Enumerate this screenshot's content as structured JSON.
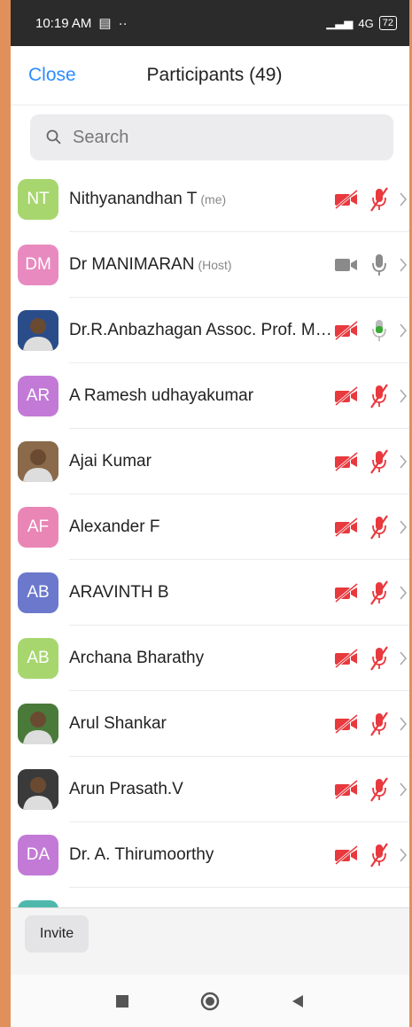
{
  "status": {
    "time": "10:19 AM",
    "network": "4G",
    "battery": "72"
  },
  "header": {
    "close_label": "Close",
    "title": "Participants (49)"
  },
  "search": {
    "placeholder": "Search"
  },
  "participants": [
    {
      "initials": "NT",
      "name": "Nithyanandhan T",
      "role": "(me)",
      "color": "#a7d66f",
      "video": "off",
      "mic": "muted"
    },
    {
      "initials": "DM",
      "name": "Dr MANIMARAN",
      "role": "(Host)",
      "color": "#e88abf",
      "video": "on",
      "mic": "on"
    },
    {
      "initials": "",
      "name": "Dr.R.Anbazhagan Assoc. Prof. Me...",
      "role": "",
      "color": "#2a4d8a",
      "video": "off",
      "mic": "active"
    },
    {
      "initials": "AR",
      "name": "A Ramesh udhayakumar",
      "role": "",
      "color": "#c27ad6",
      "video": "off",
      "mic": "muted"
    },
    {
      "initials": "",
      "name": "Ajai Kumar",
      "role": "",
      "color": "#8a6a4a",
      "video": "off",
      "mic": "muted"
    },
    {
      "initials": "AF",
      "name": "Alexander F",
      "role": "",
      "color": "#ea86b6",
      "video": "off",
      "mic": "muted"
    },
    {
      "initials": "AB",
      "name": "ARAVINTH B",
      "role": "",
      "color": "#6b78cc",
      "video": "off",
      "mic": "muted"
    },
    {
      "initials": "AB",
      "name": "Archana Bharathy",
      "role": "",
      "color": "#a7d66f",
      "video": "off",
      "mic": "muted"
    },
    {
      "initials": "",
      "name": "Arul Shankar",
      "role": "",
      "color": "#4a7a3a",
      "video": "off",
      "mic": "muted"
    },
    {
      "initials": "",
      "name": "Arun Prasath.V",
      "role": "",
      "color": "#3a3a3a",
      "video": "off",
      "mic": "muted"
    },
    {
      "initials": "DA",
      "name": "Dr. A. Thirumoorthy",
      "role": "",
      "color": "#c27ad6",
      "video": "off",
      "mic": "muted"
    }
  ],
  "footer": {
    "invite_label": "Invite"
  },
  "colors": {
    "accent": "#2d8cff",
    "muted_red": "#e8393e",
    "mic_green": "#3aaa35",
    "icon_gray": "#8a8a8a"
  }
}
